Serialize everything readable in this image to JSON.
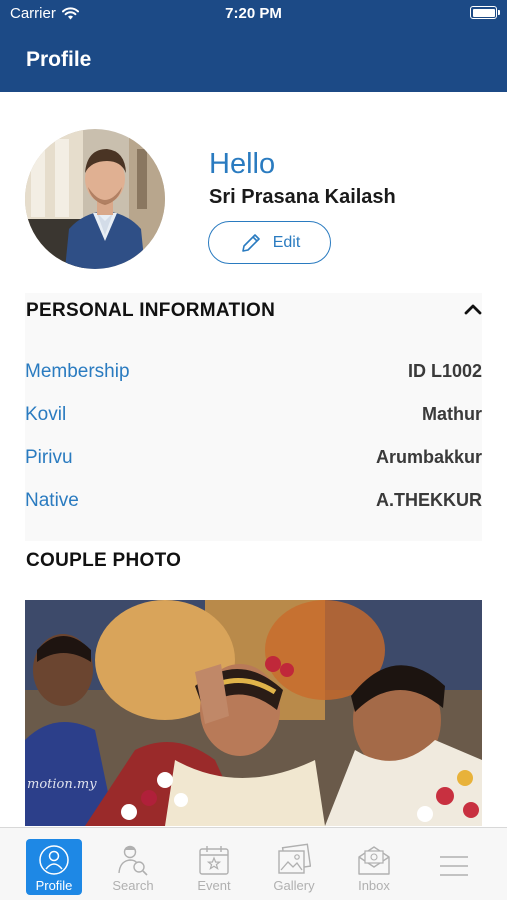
{
  "status_bar": {
    "carrier": "Carrier",
    "time": "7:20 PM"
  },
  "header": {
    "title": "Profile"
  },
  "profile": {
    "greeting": "Hello",
    "name": "Sri Prasana Kailash",
    "edit_label": "Edit"
  },
  "personal_info": {
    "title": "PERSONAL INFORMATION",
    "rows": [
      {
        "label": "Membership",
        "value": "ID L1002"
      },
      {
        "label": "Kovil",
        "value": "Mathur"
      },
      {
        "label": "Pirivu",
        "value": "Arumbakkur"
      },
      {
        "label": "Native",
        "value": "A.THEKKUR"
      }
    ]
  },
  "couple_photo": {
    "title": "COUPLE PHOTO",
    "watermark": "motion.my"
  },
  "tabs": [
    {
      "label": "Profile",
      "icon": "profile-icon",
      "active": true
    },
    {
      "label": "Search",
      "icon": "search-user-icon",
      "active": false
    },
    {
      "label": "Event",
      "icon": "calendar-icon",
      "active": false
    },
    {
      "label": "Gallery",
      "icon": "gallery-icon",
      "active": false
    },
    {
      "label": "Inbox",
      "icon": "inbox-icon",
      "active": false
    },
    {
      "label": "",
      "icon": "menu-icon",
      "active": false
    }
  ],
  "colors": {
    "header": "#1c4a86",
    "accent": "#2a7bc0",
    "tab_active": "#1e88e5"
  }
}
